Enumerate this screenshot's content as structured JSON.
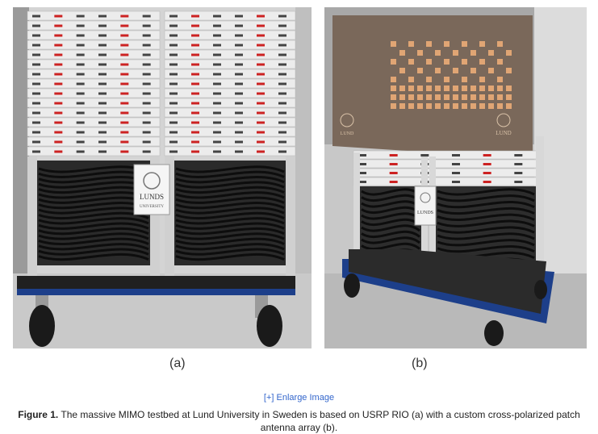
{
  "figure": {
    "subfigures": [
      {
        "label": "(a)"
      },
      {
        "label": "(b)"
      }
    ],
    "enlarge_link": "[+] Enlarge Image",
    "caption_prefix": "Figure 1.",
    "caption_text": " The massive MIMO testbed at Lund University in Sweden is based on USRP RIO (a) with a custom cross-polarized patch antenna array (b).",
    "logo_text": "LUNDS UNIVERSITY",
    "logo_text_b": "LUND UNIVERSITY"
  },
  "colors": {
    "rack_white": "#ececec",
    "cable_black": "#111111",
    "base_blue": "#1d3f8a",
    "antenna_panel": "#7a685a",
    "patch_copper": "#e0a574",
    "link_blue": "#3366cc"
  }
}
